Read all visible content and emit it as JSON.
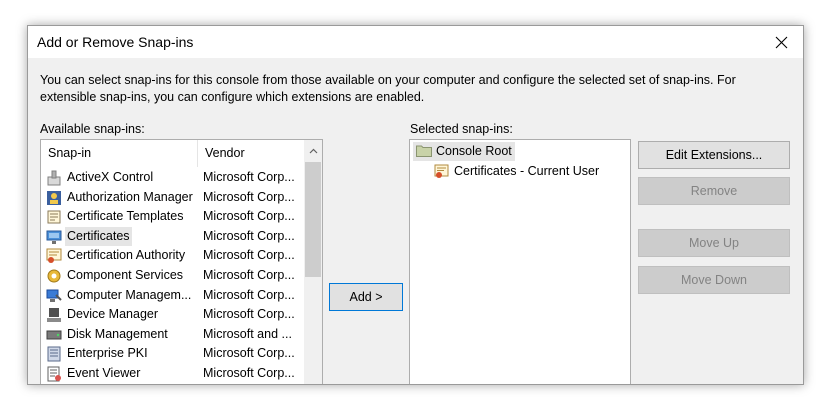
{
  "window": {
    "title": "Add or Remove Snap-ins"
  },
  "description": "You can select snap-ins for this console from those available on your computer and configure the selected set of snap-ins. For extensible snap-ins, you can configure which extensions are enabled.",
  "available": {
    "label": "Available snap-ins:",
    "columns": [
      "Snap-in",
      "Vendor"
    ],
    "rows": [
      {
        "name": "ActiveX Control",
        "vendor": "Microsoft Corp...",
        "icon": "activex-control-icon"
      },
      {
        "name": "Authorization Manager",
        "vendor": "Microsoft Corp...",
        "icon": "authorization-manager-icon"
      },
      {
        "name": "Certificate Templates",
        "vendor": "Microsoft Corp...",
        "icon": "certificate-templates-icon"
      },
      {
        "name": "Certificates",
        "vendor": "Microsoft Corp...",
        "icon": "certificates-icon",
        "selected": true
      },
      {
        "name": "Certification Authority",
        "vendor": "Microsoft Corp...",
        "icon": "certification-authority-icon"
      },
      {
        "name": "Component Services",
        "vendor": "Microsoft Corp...",
        "icon": "component-services-icon"
      },
      {
        "name": "Computer Managem...",
        "vendor": "Microsoft Corp...",
        "icon": "computer-management-icon"
      },
      {
        "name": "Device Manager",
        "vendor": "Microsoft Corp...",
        "icon": "device-manager-icon"
      },
      {
        "name": "Disk Management",
        "vendor": "Microsoft and ...",
        "icon": "disk-management-icon"
      },
      {
        "name": "Enterprise PKI",
        "vendor": "Microsoft Corp...",
        "icon": "enterprise-pki-icon"
      },
      {
        "name": "Event Viewer",
        "vendor": "Microsoft Corp...",
        "icon": "event-viewer-icon"
      }
    ]
  },
  "add_button": "Add >",
  "selected": {
    "label": "Selected snap-ins:",
    "root": "Console Root",
    "child": "Certificates - Current User"
  },
  "buttons": {
    "edit_extensions": "Edit Extensions...",
    "remove": "Remove",
    "move_up": "Move Up",
    "move_down": "Move Down"
  },
  "colors": {
    "accent": "#0078d7",
    "selection": "#e5e5e5",
    "dialog_bg": "#f0f0f0"
  }
}
